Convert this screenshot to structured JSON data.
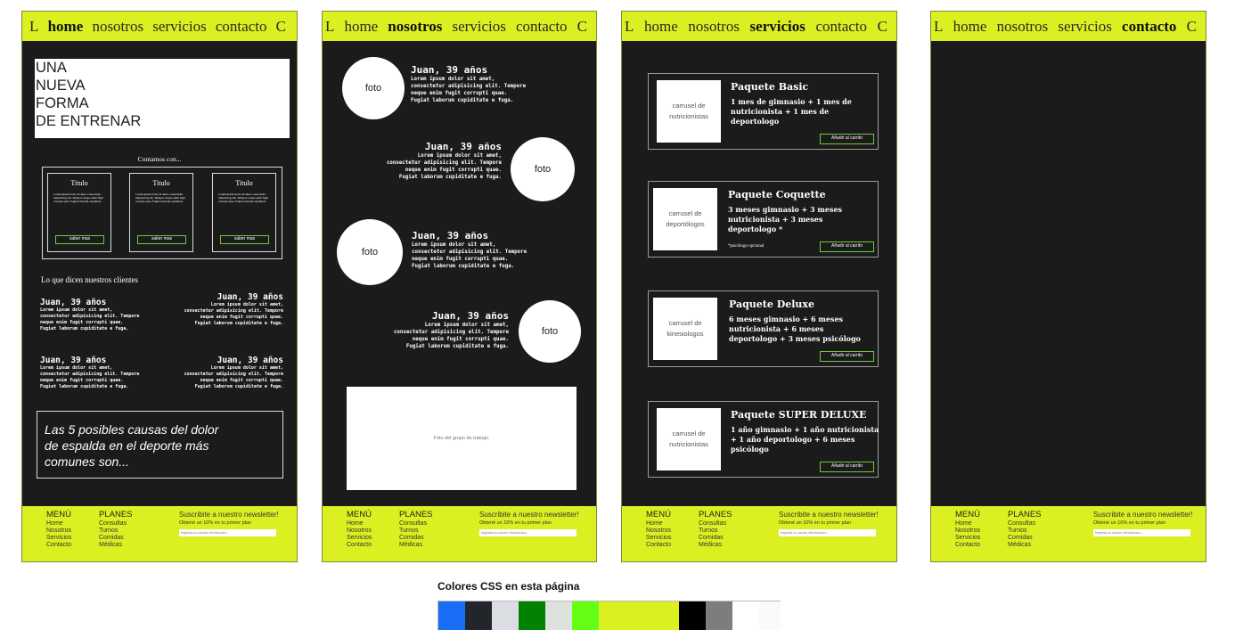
{
  "nav": {
    "logo_left": "L",
    "logo_right": "C",
    "items": [
      "home",
      "nosotros",
      "servicios",
      "contacto"
    ]
  },
  "home": {
    "hero_lines": [
      "UNA",
      "NUEVA",
      "FORMA",
      "DE ENTRENAR"
    ],
    "contamos": "Contamos con...",
    "cards": [
      {
        "title": "Titulo",
        "body": "Lorem ipsum dolor sit amet, consectetur adipisicing elit. Tempore neque enim fugit corrupti quae. Fugiat laborum cupiditate",
        "button": "saber mas"
      },
      {
        "title": "Titulo",
        "body": "Lorem ipsum dolor sit amet, consectetur adipisicing elit. Tempore neque enim fugit corrupti quae. Fugiat laborum cupiditate",
        "button": "saber mas"
      },
      {
        "title": "Titulo",
        "body": "Lorem ipsum dolor sit amet, consectetur adipisicing elit. Tempore neque enim fugit corrupti quae. Fugiat laborum cupiditate",
        "button": "saber mas"
      }
    ],
    "clients_heading": "Lo que dicen nuestros clientes",
    "testimonials": [
      {
        "name": "Juan, 39 años",
        "text": "Lorem ipsum dolor sit amet,\nconsectetur adipisicing elit. Tempore\nneque enim fugit corrupti quae.\nFugiat laborum cupiditate e fuga."
      },
      {
        "name": "Juan, 39 años",
        "text": "Lorem ipsum dolor sit amet,\nconsectetur adipisicing elit. Tempore\nneque enim fugit corrupti quae.\nFugiat laborum cupiditate e fuga."
      },
      {
        "name": "Juan, 39 años",
        "text": "Lorem ipsum dolor sit amet,\nconsectetur adipisicing elit. Tempore\nneque enim fugit corrupti quae.\nFugiat laborum cupiditate e fuga."
      },
      {
        "name": "Juan, 39 años",
        "text": "Lorem ipsum dolor sit amet,\nconsectetur adipisicing elit. Tempore\nneque enim fugit corrupti quae.\nFugiat laborum cupiditate e fuga."
      }
    ],
    "article_lines": [
      "Las 5 posibles causas del dolor",
      "de espalda en el deporte más",
      "comunes son..."
    ]
  },
  "nosotros": {
    "photo_label": "foto",
    "testimonials": [
      {
        "name": "Juan, 39 años",
        "text": "Lorem ipsum dolor sit amet,\nconsectetur adipisicing elit. Tempore\nneque enim fugit corrupti quae.\nFugiat laborum cupiditate e fuga."
      },
      {
        "name": "Juan, 39 años",
        "text": "Lorem ipsum dolor sit amet,\nconsectetur adipisicing elit. Tempore\nneque enim fugit corrupti quae.\nFugiat laborum cupiditate e fuga."
      },
      {
        "name": "Juan, 39 años",
        "text": "Lorem ipsum dolor sit amet,\nconsectetur adipisicing elit. Tempore\nneque enim fugit corrupti quae.\nFugiat laborum cupiditate e fuga."
      },
      {
        "name": "Juan, 39 años",
        "text": "Lorem ipsum dolor sit amet,\nconsectetur adipisicing elit. Tempore\nneque enim fugit corrupti quae.\nFugiat laborum cupiditate e fuga."
      }
    ],
    "group_photo": "Foto del grupo de trabajo."
  },
  "servicios": {
    "add_label": "Añadir al carrito",
    "packages": [
      {
        "image": "carrusel de nutricionistas",
        "title": "Paquete Basic",
        "desc": "1 mes de gimnasio + 1 mes de\nnutricionista + 1 mes de\ndeportologo",
        "note": ""
      },
      {
        "image": "carrusel de deportólogos",
        "title": "Paquete Coquette",
        "desc": "3 meses gimnasio + 3 meses\nnutricionista + 3 meses\ndeportologo *",
        "note": "*psicólogo opcional"
      },
      {
        "image": "carrusel de kinesiologos",
        "title": "Paquete Deluxe",
        "desc": "6 meses gimnasio + 6 meses\nnutricionista + 6 meses\ndeportologo + 3 meses psicólogo",
        "note": ""
      },
      {
        "image": "carrusel de nutricionistas",
        "title": "Paquete SUPER DELUXE",
        "desc": "1 año gimnasio + 1 año nutricionista\n+ 1 año deportologo + 6 meses\npsicólogo",
        "note": ""
      }
    ]
  },
  "footer": {
    "menu_title": "MENÚ",
    "menu_items": [
      "Home",
      "Nosotros",
      "Servicios",
      "Contacto"
    ],
    "plans_title": "PLANES",
    "plans_items": [
      "Consultas",
      "Turnos",
      "Comidas",
      "Médicas"
    ],
    "newsletter_title": "Suscribite a nuestro newsletter!",
    "newsletter_sub": "Obtené un 10% en tu primer plan",
    "newsletter_placeholder": "Ingresá tu correo electrónico..."
  },
  "palette": {
    "title": "Colores CSS en esta página",
    "colors": [
      "#1a6ef5",
      "#22252a",
      "#dadde1",
      "#028203",
      "#dce2dc",
      "#64ff12",
      "#dcf021",
      "#dcf021",
      "#dcf021",
      "#000000",
      "#7d7d7d",
      "#ffffff",
      "#fafafa"
    ]
  }
}
